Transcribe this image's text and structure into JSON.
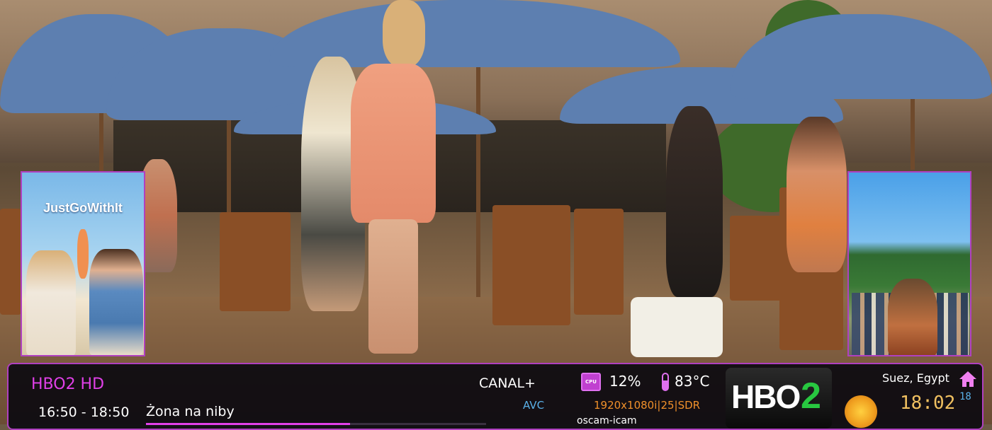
{
  "posters": {
    "left_title": "JustGoWithIt"
  },
  "infobar": {
    "channel_name": "HBO2 HD",
    "time_range": "16:50 - 18:50",
    "program_title": "Żona na niby",
    "progress_fraction": 0.6,
    "provider": "CANAL+",
    "codec": "AVC",
    "cpu_usage": "12%",
    "temperature": "83°C",
    "resolution": "1920x1080i|25|SDR",
    "cam": "oscam-icam",
    "location": "Suez, Egypt",
    "clock": "18:02",
    "seconds": "18"
  },
  "logo": {
    "hbo": "HBO",
    "two": "2"
  },
  "colors": {
    "accent": "#e040e8",
    "codec": "#5ab0e8",
    "resolution": "#f0902a",
    "clock": "#f0c060",
    "logo_green": "#28c840"
  },
  "icons": {
    "cpu": "cpu-icon",
    "temperature": "thermometer-icon",
    "weather": "sun-icon",
    "home": "home-icon"
  }
}
